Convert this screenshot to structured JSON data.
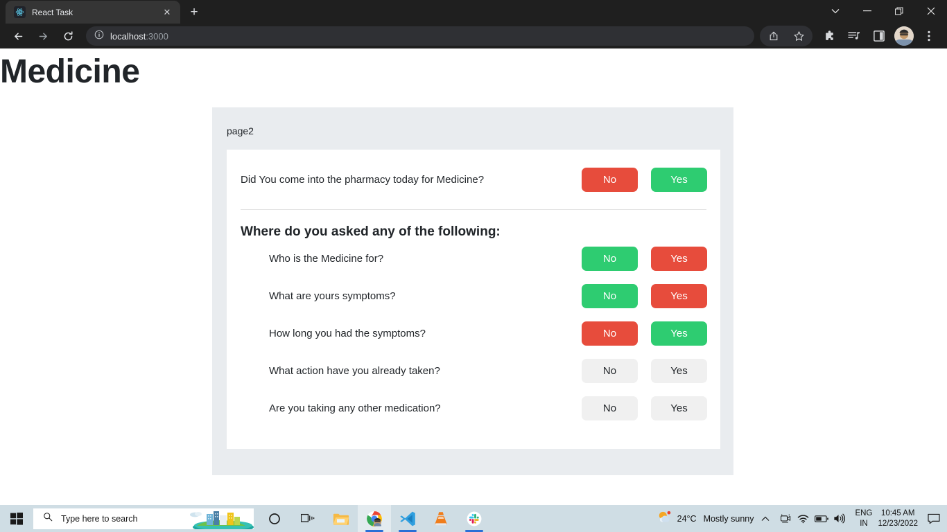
{
  "browser": {
    "tab": {
      "title": "React Task",
      "favicon": "react-logo-icon",
      "close": "✕"
    },
    "new_tab": "+",
    "window_controls": {
      "tab_search": "⌄",
      "minimize": "—",
      "maximize": "❐",
      "close": "✕"
    },
    "nav": {
      "back": "back-arrow-icon",
      "forward": "forward-arrow-icon",
      "reload": "reload-icon"
    },
    "omnibox": {
      "info_icon": "site-info-icon",
      "host": "localhost",
      "port": ":3000"
    },
    "toolbar_right": {
      "share": "share-icon",
      "bookmark": "star-icon",
      "extensions": "puzzle-icon",
      "media": "media-playlist-icon",
      "split_screen": "split-screen-icon",
      "profile": "profile-avatar",
      "menu": "three-dot-menu-icon"
    }
  },
  "page": {
    "heading": "Medicine",
    "card_label": "page2",
    "first_question": {
      "text": "Did You come into the pharmacy today for Medicine?",
      "no_label": "No",
      "yes_label": "Yes",
      "no_state": "red",
      "yes_state": "green"
    },
    "section_heading": "Where do you asked any of the following:",
    "questions": [
      {
        "text": "Who is the Medicine for?",
        "no_label": "No",
        "yes_label": "Yes",
        "no_state": "green",
        "yes_state": "red"
      },
      {
        "text": "What are yours symptoms?",
        "no_label": "No",
        "yes_label": "Yes",
        "no_state": "green",
        "yes_state": "red"
      },
      {
        "text": "How long you had the symptoms?",
        "no_label": "No",
        "yes_label": "Yes",
        "no_state": "red",
        "yes_state": "green"
      },
      {
        "text": "What action have you already taken?",
        "no_label": "No",
        "yes_label": "Yes",
        "no_state": "gray",
        "yes_state": "gray"
      },
      {
        "text": "Are you taking any other medication?",
        "no_label": "No",
        "yes_label": "Yes",
        "no_state": "gray",
        "yes_state": "gray"
      }
    ],
    "colors": {
      "red": "#e74c3c",
      "green": "#2ecc71",
      "gray": "#f0f0f0",
      "outer_card": "#e9ecef",
      "inner_card": "#ffffff",
      "text": "#212529"
    }
  },
  "taskbar": {
    "start": "windows-start-icon",
    "search_placeholder": "Type here to search",
    "icons": [
      {
        "name": "cortana-icon",
        "active": false
      },
      {
        "name": "task-view-icon",
        "active": false
      },
      {
        "name": "file-explorer-icon",
        "active": false
      },
      {
        "name": "chrome-icon",
        "active": true
      },
      {
        "name": "vscode-icon",
        "active": false
      },
      {
        "name": "vlc-icon",
        "active": false
      },
      {
        "name": "slack-icon",
        "active": false
      }
    ],
    "weather": {
      "temp": "24°C",
      "condition": "Mostly sunny"
    },
    "tray": {
      "show_hidden": "chevron-up-icon",
      "camera": "webcam-icon",
      "network": "wifi-icon",
      "battery": "battery-icon",
      "volume": "volume-icon"
    },
    "language": {
      "line1": "ENG",
      "line2": "IN"
    },
    "clock": {
      "time": "10:45 AM",
      "date": "12/23/2022"
    },
    "notifications": "notification-icon"
  }
}
